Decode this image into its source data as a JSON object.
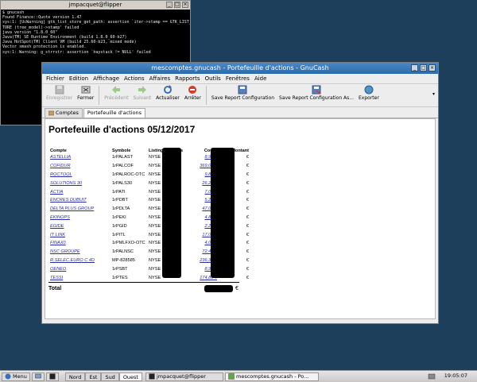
{
  "terminal": {
    "title": "jmpacquet@flipper",
    "lines": [
      "$ gnucash",
      "Found Finance::Quote version 1.47",
      "sys:1: [UcWarning] gtk_list_store_get_path: assertion `iter->stamp == GTK_LIST_S",
      "TORE (tree_model)->stamp' failed",
      "java version \"1.8.0_60\"",
      "Java(TM) SE Runtime Environment (build 1.8.0_60-b27)",
      "Java HotSpot(TM) Client VM (build 25.60-b23, mixed mode)",
      "Vector smash protection is enabled.",
      "sys:1: Warning: g_strrstr: assertion `haystack != NULL' failed"
    ]
  },
  "gnucash": {
    "title": "mescomptes.gnucash - Portefeuille d'actions - GnuCash",
    "menu": [
      "Fichier",
      "Edition",
      "Affichage",
      "Actions",
      "Affaires",
      "Rapports",
      "Outils",
      "Fenêtres",
      "Aide"
    ],
    "toolbar": {
      "save": "Enregistrer",
      "close": "Fermer",
      "back": "Précédent",
      "forward": "Suivant",
      "reload": "Actualiser",
      "stop": "Arrêter",
      "save_report": "Save Report Configuration",
      "save_report_as": "Save Report Configuration As...",
      "export": "Exporter"
    },
    "tabs": [
      "Comptes",
      "Portefeuille d'actions"
    ],
    "report": {
      "title": "Portefeuille d'actions 05/12/2017",
      "columns": [
        "Compte",
        "Symbole",
        "Listing",
        "Unités",
        "Cours",
        "Montant"
      ],
      "rows": [
        {
          "account": "ASTELLIA",
          "symbol": "1rPALAST",
          "listing": "NYSE",
          "price": "8,94 €"
        },
        {
          "account": "COFIDUR",
          "symbol": "1rPALCOF",
          "listing": "NYSE",
          "price": "369,00 €"
        },
        {
          "account": "ROCTOOL",
          "symbol": "1rPALROC-OTC",
          "listing": "NYSE",
          "price": "9,80 €"
        },
        {
          "account": "SOLUTIONS 30",
          "symbol": "1rPALS30",
          "listing": "NYSE",
          "price": "26,25 €"
        },
        {
          "account": "ACTIA",
          "symbol": "1rPATI",
          "listing": "NYSE",
          "price": "7,00 €"
        },
        {
          "account": "ENCRES DUBUIT",
          "symbol": "1rPDBT",
          "listing": "NYSE",
          "price": "5,28 €"
        },
        {
          "account": "DELTA PLUS GROUP",
          "symbol": "1rPDLTA",
          "listing": "NYSE",
          "price": "47,05 €"
        },
        {
          "account": "EKINOPS",
          "symbol": "1rPEKI",
          "listing": "NYSE",
          "price": "4,83 €"
        },
        {
          "account": "EGIDE",
          "symbol": "1rPGID",
          "listing": "NYSE",
          "price": "2,26 €"
        },
        {
          "account": "IT LINK",
          "symbol": "1rPITL",
          "listing": "NYSE",
          "price": "17,00 €"
        },
        {
          "account": "FINAX0",
          "symbol": "1rPMLFXO-OTC",
          "listing": "NYSE",
          "price": "4,01 €"
        },
        {
          "account": "NSC GROUPE",
          "symbol": "1rPALNSC",
          "listing": "NYSE",
          "price": "72,49 €"
        },
        {
          "account": "R.SELEC.EURO C 4D",
          "symbol": "MP-828585",
          "listing": "NYSE",
          "price": "236,39 €"
        },
        {
          "account": "OENEO",
          "symbol": "1rPSBT",
          "listing": "NYSE",
          "price": "8,90 €"
        },
        {
          "account": "TESSI",
          "symbol": "1rPTES",
          "listing": "NYSE",
          "price": "174,86 €"
        }
      ],
      "amount_currency": "€",
      "total_label": "Total",
      "total_currency": "€"
    }
  },
  "panel": {
    "menu_label": "Menu",
    "workspaces": [
      "Nord",
      "Est",
      "Sud",
      "Ouest"
    ],
    "active_workspace": "Ouest",
    "tasks": [
      "jmpacquet@flipper",
      "mescomptes.gnucash - Po..."
    ],
    "clock": "19:05:07"
  }
}
